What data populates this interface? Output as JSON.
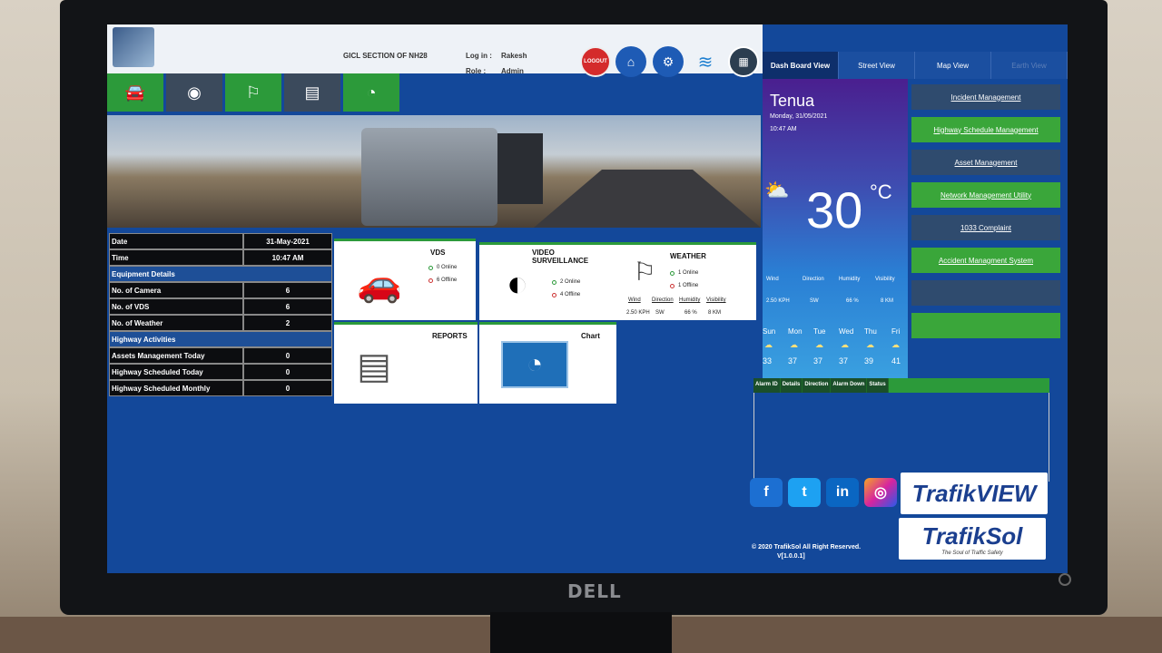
{
  "header": {
    "title": "GICL SECTION OF NH28",
    "login_label": "Log in :",
    "login_value": "Rakesh",
    "role_label": "Role :",
    "role_value": "Admin",
    "logout_label": "LOGOUT"
  },
  "tabs": [
    "Dash Board View",
    "Street View",
    "Map View",
    "Earth View"
  ],
  "info": {
    "date_label": "Date",
    "date_value": "31-May-2021",
    "time_label": "Time",
    "time_value": "10:47 AM",
    "equipment_header": "Equipment Details",
    "camera_label": "No. of Camera",
    "camera_value": "6",
    "vds_label": "No. of VDS",
    "vds_value": "6",
    "weather_label": "No. of Weather",
    "weather_value": "2",
    "activities_header": "Highway Activities",
    "assets_label": "Assets Management Today",
    "assets_value": "0",
    "sched_today_label": "Highway Scheduled Today",
    "sched_today_value": "0",
    "sched_month_label": "Highway Scheduled Monthly",
    "sched_month_value": "0"
  },
  "tiles": {
    "vds": {
      "title": "VDS",
      "online": "0 Online",
      "offline": "6 Offline"
    },
    "video": {
      "title": "VIDEO SURVEILLANCE",
      "online": "2 Online",
      "offline": "4 Offline"
    },
    "weather": {
      "title": "WEATHER",
      "online": "1 Online",
      "offline": "1 Offline",
      "labels": [
        "Wind",
        "Direction",
        "Humidity",
        "Visibility"
      ],
      "values": [
        "2.50 KPH",
        "SW",
        "66 %",
        "8 KM"
      ]
    },
    "reports": {
      "title": "REPORTS"
    },
    "chart": {
      "title": "Chart"
    }
  },
  "weather_panel": {
    "city": "Tenua",
    "date": "Monday, 31/05/2021",
    "time": "10:47 AM",
    "temp": "30",
    "unit": "°C",
    "labels": [
      "Wind",
      "Direction",
      "Humidity",
      "Visibility"
    ],
    "values": [
      "2.50 KPH",
      "SW",
      "66 %",
      "8 KM"
    ],
    "days": [
      "Sun",
      "Mon",
      "Tue",
      "Wed",
      "Thu",
      "Fri"
    ],
    "day_temps": [
      "33",
      "37",
      "37",
      "37",
      "39",
      "41"
    ]
  },
  "menu": [
    "Incident Management",
    "Highway Schedule Management",
    "Asset Management",
    "Network Management Utility",
    "1033 Complaint",
    "Accident Managment System",
    ""
  ],
  "alarm_columns": [
    "Alarm ID",
    "Details",
    "Direction",
    "Alarm Down",
    "Status"
  ],
  "footer": {
    "copyright": "© 2020 TrafikSol All Right Reserved.",
    "version": "V[1.0.0.1]",
    "trafikview": "TrafikVIEW",
    "trafiksol": "TrafikSol",
    "tagline": "The Soul of Traffic Safety"
  },
  "monitor_brand": "DELL"
}
